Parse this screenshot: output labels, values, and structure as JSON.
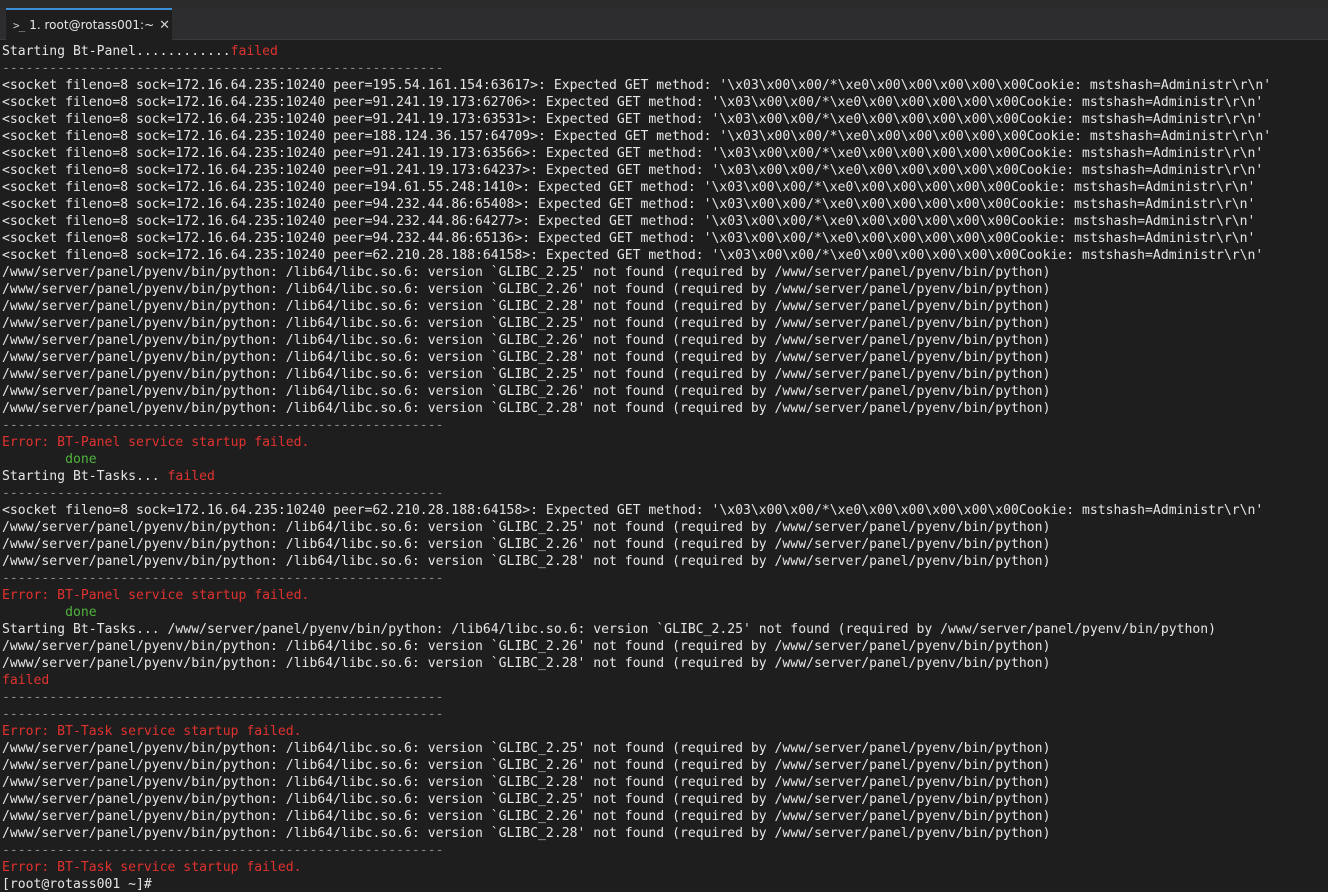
{
  "tab": {
    "icon": "terminal-prompt-icon",
    "label": "1. root@rotass001:~",
    "close": "✕"
  },
  "colors": {
    "background": "#1e1e1e",
    "text": "#e5e5e5",
    "error": "#e0322f",
    "success": "#4fb43c",
    "separator": "#8a8a8a",
    "tab_accent": "#3c8fd7"
  },
  "terminal": {
    "lines": [
      {
        "parts": [
          {
            "t": "Starting Bt-Panel............",
            "c": "normal"
          },
          {
            "t": "failed",
            "c": "fail"
          }
        ]
      },
      {
        "parts": [
          {
            "t": "--------------------------------------------------------",
            "c": "sep"
          }
        ]
      },
      {
        "parts": [
          {
            "t": "<socket fileno=8 sock=172.16.64.235:10240 peer=195.54.161.154:63617>: Expected GET method: '\\x03\\x00\\x00/*\\xe0\\x00\\x00\\x00\\x00\\x00Cookie: mstshash=Administr\\r\\n'",
            "c": "normal"
          }
        ]
      },
      {
        "parts": [
          {
            "t": "<socket fileno=8 sock=172.16.64.235:10240 peer=91.241.19.173:62706>: Expected GET method: '\\x03\\x00\\x00/*\\xe0\\x00\\x00\\x00\\x00\\x00Cookie: mstshash=Administr\\r\\n'",
            "c": "normal"
          }
        ]
      },
      {
        "parts": [
          {
            "t": "<socket fileno=8 sock=172.16.64.235:10240 peer=91.241.19.173:63531>: Expected GET method: '\\x03\\x00\\x00/*\\xe0\\x00\\x00\\x00\\x00\\x00Cookie: mstshash=Administr\\r\\n'",
            "c": "normal"
          }
        ]
      },
      {
        "parts": [
          {
            "t": "<socket fileno=8 sock=172.16.64.235:10240 peer=188.124.36.157:64709>: Expected GET method: '\\x03\\x00\\x00/*\\xe0\\x00\\x00\\x00\\x00\\x00Cookie: mstshash=Administr\\r\\n'",
            "c": "normal"
          }
        ]
      },
      {
        "parts": [
          {
            "t": "<socket fileno=8 sock=172.16.64.235:10240 peer=91.241.19.173:63566>: Expected GET method: '\\x03\\x00\\x00/*\\xe0\\x00\\x00\\x00\\x00\\x00Cookie: mstshash=Administr\\r\\n'",
            "c": "normal"
          }
        ]
      },
      {
        "parts": [
          {
            "t": "<socket fileno=8 sock=172.16.64.235:10240 peer=91.241.19.173:64237>: Expected GET method: '\\x03\\x00\\x00/*\\xe0\\x00\\x00\\x00\\x00\\x00Cookie: mstshash=Administr\\r\\n'",
            "c": "normal"
          }
        ]
      },
      {
        "parts": [
          {
            "t": "<socket fileno=8 sock=172.16.64.235:10240 peer=194.61.55.248:1410>: Expected GET method: '\\x03\\x00\\x00/*\\xe0\\x00\\x00\\x00\\x00\\x00Cookie: mstshash=Administr\\r\\n'",
            "c": "normal"
          }
        ]
      },
      {
        "parts": [
          {
            "t": "<socket fileno=8 sock=172.16.64.235:10240 peer=94.232.44.86:65408>: Expected GET method: '\\x03\\x00\\x00/*\\xe0\\x00\\x00\\x00\\x00\\x00Cookie: mstshash=Administr\\r\\n'",
            "c": "normal"
          }
        ]
      },
      {
        "parts": [
          {
            "t": "<socket fileno=8 sock=172.16.64.235:10240 peer=94.232.44.86:64277>: Expected GET method: '\\x03\\x00\\x00/*\\xe0\\x00\\x00\\x00\\x00\\x00Cookie: mstshash=Administr\\r\\n'",
            "c": "normal"
          }
        ]
      },
      {
        "parts": [
          {
            "t": "<socket fileno=8 sock=172.16.64.235:10240 peer=94.232.44.86:65136>: Expected GET method: '\\x03\\x00\\x00/*\\xe0\\x00\\x00\\x00\\x00\\x00Cookie: mstshash=Administr\\r\\n'",
            "c": "normal"
          }
        ]
      },
      {
        "parts": [
          {
            "t": "<socket fileno=8 sock=172.16.64.235:10240 peer=62.210.28.188:64158>: Expected GET method: '\\x03\\x00\\x00/*\\xe0\\x00\\x00\\x00\\x00\\x00Cookie: mstshash=Administr\\r\\n'",
            "c": "normal"
          }
        ]
      },
      {
        "parts": [
          {
            "t": "/www/server/panel/pyenv/bin/python: /lib64/libc.so.6: version `GLIBC_2.25' not found (required by /www/server/panel/pyenv/bin/python)",
            "c": "normal"
          }
        ]
      },
      {
        "parts": [
          {
            "t": "/www/server/panel/pyenv/bin/python: /lib64/libc.so.6: version `GLIBC_2.26' not found (required by /www/server/panel/pyenv/bin/python)",
            "c": "normal"
          }
        ]
      },
      {
        "parts": [
          {
            "t": "/www/server/panel/pyenv/bin/python: /lib64/libc.so.6: version `GLIBC_2.28' not found (required by /www/server/panel/pyenv/bin/python)",
            "c": "normal"
          }
        ]
      },
      {
        "parts": [
          {
            "t": "/www/server/panel/pyenv/bin/python: /lib64/libc.so.6: version `GLIBC_2.25' not found (required by /www/server/panel/pyenv/bin/python)",
            "c": "normal"
          }
        ]
      },
      {
        "parts": [
          {
            "t": "/www/server/panel/pyenv/bin/python: /lib64/libc.so.6: version `GLIBC_2.26' not found (required by /www/server/panel/pyenv/bin/python)",
            "c": "normal"
          }
        ]
      },
      {
        "parts": [
          {
            "t": "/www/server/panel/pyenv/bin/python: /lib64/libc.so.6: version `GLIBC_2.28' not found (required by /www/server/panel/pyenv/bin/python)",
            "c": "normal"
          }
        ]
      },
      {
        "parts": [
          {
            "t": "/www/server/panel/pyenv/bin/python: /lib64/libc.so.6: version `GLIBC_2.25' not found (required by /www/server/panel/pyenv/bin/python)",
            "c": "normal"
          }
        ]
      },
      {
        "parts": [
          {
            "t": "/www/server/panel/pyenv/bin/python: /lib64/libc.so.6: version `GLIBC_2.26' not found (required by /www/server/panel/pyenv/bin/python)",
            "c": "normal"
          }
        ]
      },
      {
        "parts": [
          {
            "t": "/www/server/panel/pyenv/bin/python: /lib64/libc.so.6: version `GLIBC_2.28' not found (required by /www/server/panel/pyenv/bin/python)",
            "c": "normal"
          }
        ]
      },
      {
        "parts": [
          {
            "t": "--------------------------------------------------------",
            "c": "sep"
          }
        ]
      },
      {
        "parts": [
          {
            "t": "Error: BT-Panel service startup failed.",
            "c": "err"
          }
        ]
      },
      {
        "parts": [
          {
            "t": "        ",
            "c": "normal"
          },
          {
            "t": "done",
            "c": "ok"
          }
        ]
      },
      {
        "parts": [
          {
            "t": "Starting Bt-Tasks... ",
            "c": "normal"
          },
          {
            "t": "failed",
            "c": "fail"
          }
        ]
      },
      {
        "parts": [
          {
            "t": "--------------------------------------------------------",
            "c": "sep"
          }
        ]
      },
      {
        "parts": [
          {
            "t": "<socket fileno=8 sock=172.16.64.235:10240 peer=62.210.28.188:64158>: Expected GET method: '\\x03\\x00\\x00/*\\xe0\\x00\\x00\\x00\\x00\\x00Cookie: mstshash=Administr\\r\\n'",
            "c": "normal"
          }
        ]
      },
      {
        "parts": [
          {
            "t": "/www/server/panel/pyenv/bin/python: /lib64/libc.so.6: version `GLIBC_2.25' not found (required by /www/server/panel/pyenv/bin/python)",
            "c": "normal"
          }
        ]
      },
      {
        "parts": [
          {
            "t": "/www/server/panel/pyenv/bin/python: /lib64/libc.so.6: version `GLIBC_2.26' not found (required by /www/server/panel/pyenv/bin/python)",
            "c": "normal"
          }
        ]
      },
      {
        "parts": [
          {
            "t": "/www/server/panel/pyenv/bin/python: /lib64/libc.so.6: version `GLIBC_2.28' not found (required by /www/server/panel/pyenv/bin/python)",
            "c": "normal"
          }
        ]
      },
      {
        "parts": [
          {
            "t": "--------------------------------------------------------",
            "c": "sep"
          }
        ]
      },
      {
        "parts": [
          {
            "t": "Error: BT-Panel service startup failed.",
            "c": "err"
          }
        ]
      },
      {
        "parts": [
          {
            "t": "        ",
            "c": "normal"
          },
          {
            "t": "done",
            "c": "ok"
          }
        ]
      },
      {
        "parts": [
          {
            "t": "Starting Bt-Tasks... /www/server/panel/pyenv/bin/python: /lib64/libc.so.6: version `GLIBC_2.25' not found (required by /www/server/panel/pyenv/bin/python)",
            "c": "normal"
          }
        ]
      },
      {
        "parts": [
          {
            "t": "/www/server/panel/pyenv/bin/python: /lib64/libc.so.6: version `GLIBC_2.26' not found (required by /www/server/panel/pyenv/bin/python)",
            "c": "normal"
          }
        ]
      },
      {
        "parts": [
          {
            "t": "/www/server/panel/pyenv/bin/python: /lib64/libc.so.6: version `GLIBC_2.28' not found (required by /www/server/panel/pyenv/bin/python)",
            "c": "normal"
          }
        ]
      },
      {
        "parts": [
          {
            "t": "failed",
            "c": "fail"
          }
        ]
      },
      {
        "parts": [
          {
            "t": "--------------------------------------------------------",
            "c": "sep"
          }
        ]
      },
      {
        "parts": [
          {
            "t": "--------------------------------------------------------",
            "c": "sep"
          }
        ]
      },
      {
        "parts": [
          {
            "t": "Error: BT-Task service startup failed.",
            "c": "err"
          }
        ]
      },
      {
        "parts": [
          {
            "t": "/www/server/panel/pyenv/bin/python: /lib64/libc.so.6: version `GLIBC_2.25' not found (required by /www/server/panel/pyenv/bin/python)",
            "c": "normal"
          }
        ]
      },
      {
        "parts": [
          {
            "t": "/www/server/panel/pyenv/bin/python: /lib64/libc.so.6: version `GLIBC_2.26' not found (required by /www/server/panel/pyenv/bin/python)",
            "c": "normal"
          }
        ]
      },
      {
        "parts": [
          {
            "t": "/www/server/panel/pyenv/bin/python: /lib64/libc.so.6: version `GLIBC_2.28' not found (required by /www/server/panel/pyenv/bin/python)",
            "c": "normal"
          }
        ]
      },
      {
        "parts": [
          {
            "t": "/www/server/panel/pyenv/bin/python: /lib64/libc.so.6: version `GLIBC_2.25' not found (required by /www/server/panel/pyenv/bin/python)",
            "c": "normal"
          }
        ]
      },
      {
        "parts": [
          {
            "t": "/www/server/panel/pyenv/bin/python: /lib64/libc.so.6: version `GLIBC_2.26' not found (required by /www/server/panel/pyenv/bin/python)",
            "c": "normal"
          }
        ]
      },
      {
        "parts": [
          {
            "t": "/www/server/panel/pyenv/bin/python: /lib64/libc.so.6: version `GLIBC_2.28' not found (required by /www/server/panel/pyenv/bin/python)",
            "c": "normal"
          }
        ]
      },
      {
        "parts": [
          {
            "t": "--------------------------------------------------------",
            "c": "sep"
          }
        ]
      },
      {
        "parts": [
          {
            "t": "Error: BT-Task service startup failed.",
            "c": "err"
          }
        ]
      },
      {
        "parts": [
          {
            "t": "[root@rotass001 ~]#",
            "c": "normal"
          }
        ]
      }
    ]
  }
}
